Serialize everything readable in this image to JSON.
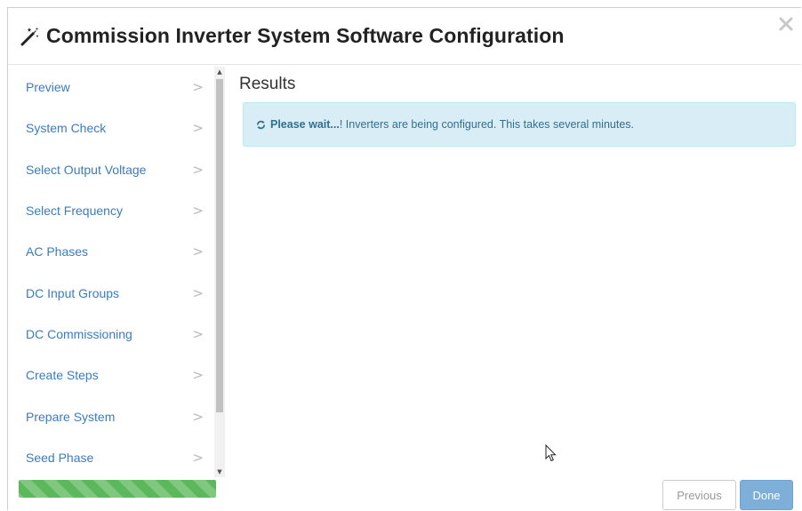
{
  "dialog": {
    "title": "Commission Inverter System Software Configuration"
  },
  "sidebar": {
    "items": [
      {
        "label": "Preview"
      },
      {
        "label": "System Check"
      },
      {
        "label": "Select Output Voltage"
      },
      {
        "label": "Select Frequency"
      },
      {
        "label": "AC Phases"
      },
      {
        "label": "DC Input Groups"
      },
      {
        "label": "DC Commissioning"
      },
      {
        "label": "Create Steps"
      },
      {
        "label": "Prepare System"
      },
      {
        "label": "Seed Phase"
      }
    ],
    "chevron": ">",
    "progress_percent": 100
  },
  "main": {
    "heading": "Results",
    "alert": {
      "bold": "Please wait...",
      "text": "! Inverters are being configured. This takes several minutes."
    }
  },
  "footer": {
    "previous_label": "Previous",
    "done_label": "Done"
  },
  "icons": {
    "title": "magic-wand-icon",
    "close": "close-icon",
    "alert": "refresh-spinner-icon"
  },
  "colors": {
    "link": "#3a7cbf",
    "alert_bg": "#d9edf7",
    "alert_text": "#31708f",
    "progress": "#5cb85c",
    "done_button": "#7eafd8"
  }
}
